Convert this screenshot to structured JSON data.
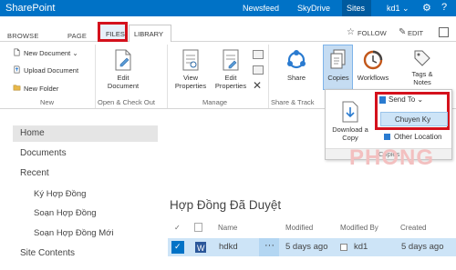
{
  "suite": {
    "brand": "SharePoint",
    "links": [
      "Newsfeed",
      "SkyDrive",
      "Sites"
    ],
    "user": "kd1 ⌄",
    "gear": "⚙",
    "help": "?"
  },
  "tabs": {
    "browse": "BROWSE",
    "page": "PAGE",
    "files": "FILES",
    "library": "LIBRARY",
    "follow": "FOLLOW",
    "edit": "EDIT"
  },
  "ribbon": {
    "new_group": {
      "new_document": "New Document ⌄",
      "upload_document": "Upload Document",
      "new_folder": "New Folder",
      "label": "New"
    },
    "open_group": {
      "edit_document_line1": "Edit",
      "edit_document_line2": "Document",
      "label": "Open & Check Out"
    },
    "manage_group": {
      "view_properties_line1": "View",
      "view_properties_line2": "Properties",
      "edit_properties_line1": "Edit",
      "edit_properties_line2": "Properties",
      "label": "Manage"
    },
    "share_group": {
      "share": "Share",
      "label": "Share & Track"
    },
    "copies_group": {
      "copies": "Copies",
      "workflows": "Workflows",
      "tags_line1": "Tags &",
      "tags_line2": "Notes"
    }
  },
  "copies_menu": {
    "download_line1": "Download a",
    "download_line2": "Copy",
    "send_to": "Send To ⌄",
    "chuyen_ky": "Chuyen Ky",
    "other_location": "Other Location",
    "header": "Copies"
  },
  "nav": {
    "home": "Home",
    "documents": "Documents",
    "recent": "Recent",
    "recent_items": [
      "Ký Hợp Đồng",
      "Soạn Hợp Đồng",
      "Soạn Hợp Đồng Mới"
    ],
    "site_contents": "Site Contents"
  },
  "watermark": "PHONG",
  "list": {
    "title": "Hợp Đồng Đã Duyệt",
    "columns": {
      "check": "✓",
      "name": "Name",
      "modified": "Modified",
      "modified_by": "Modified By",
      "created": "Created"
    },
    "row": {
      "name": "hdkd",
      "ellipsis": "···",
      "modified": "5 days ago",
      "modified_by": "kd1",
      "created": "5 days ago"
    }
  },
  "colors": {
    "suite_blue": "#0072c6",
    "highlight_red": "#d4111c",
    "selection_blue": "#cde4f7"
  }
}
